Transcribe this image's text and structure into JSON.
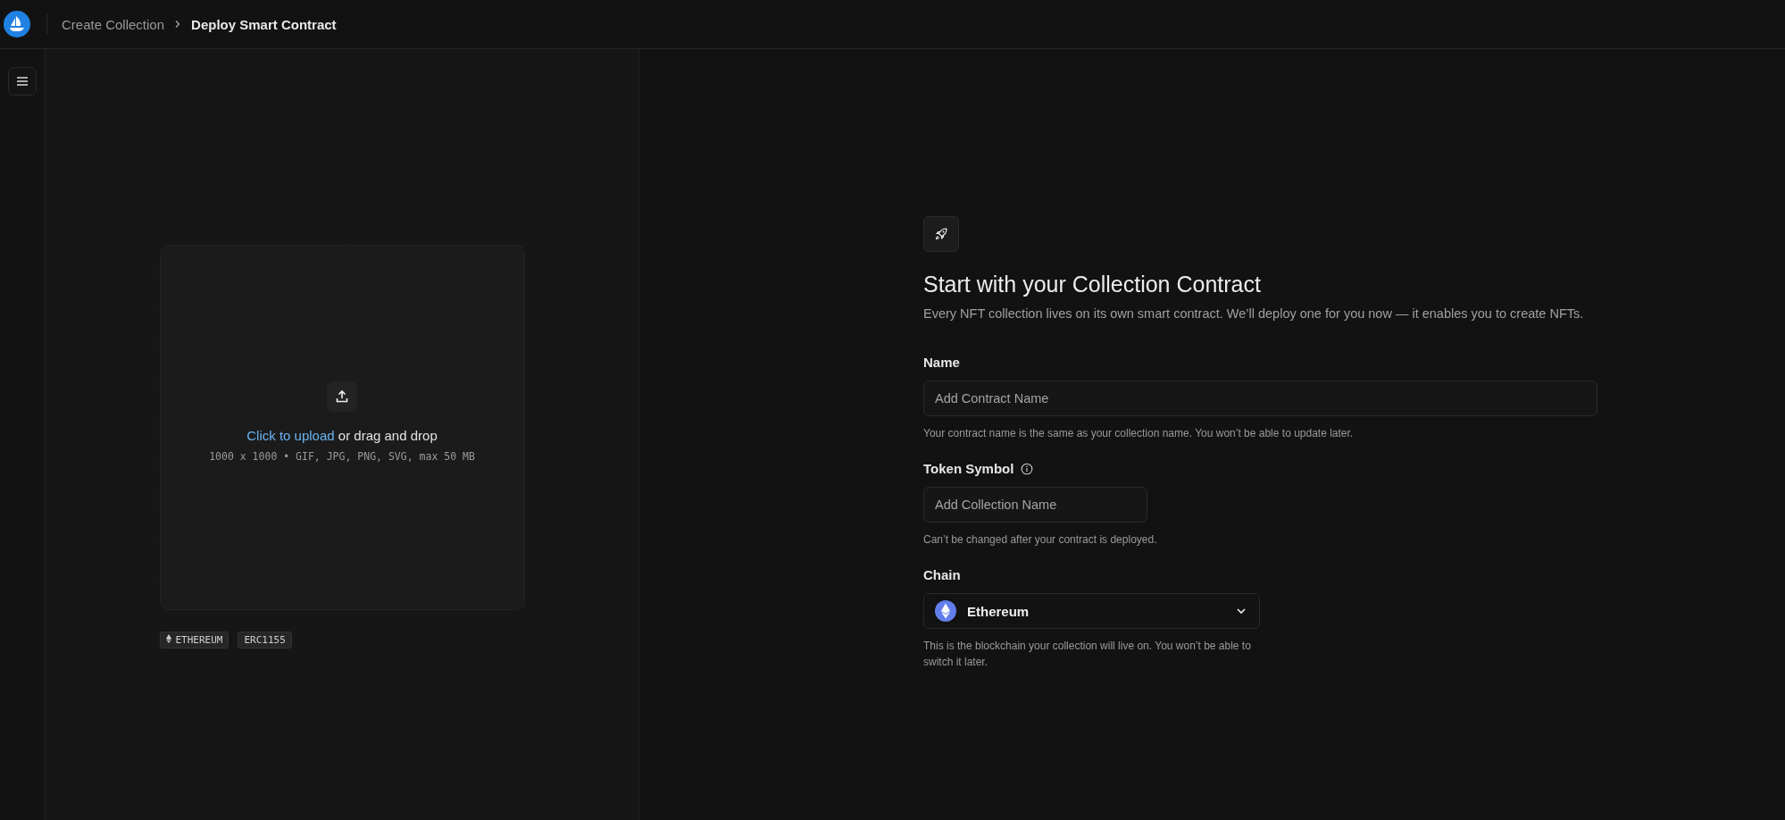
{
  "breadcrumbs": [
    {
      "label": "Create Collection",
      "selected": false
    },
    {
      "label": "Deploy Smart Contract",
      "selected": true
    }
  ],
  "upload": {
    "link": "Click to upload",
    "rest": "or drag and drop",
    "hint": "1000 x 1000 • GIF, JPG, PNG, SVG, max 50 MB"
  },
  "tags": [
    {
      "label": "ETHEREUM",
      "kind": "chain"
    },
    {
      "label": "ERC1155",
      "kind": "plain"
    }
  ],
  "form": {
    "title": "Start with your Collection Contract",
    "subtitle": "Every NFT collection lives on its own smart contract. We’ll deploy one for you now — it enables you to create NFTs.",
    "fields": [
      {
        "kind": "input",
        "label": "Name",
        "placeholder": "Add Contract Name",
        "help": "Your contract name is the same as your collection name. You won’t be able to update later.",
        "info": false
      },
      {
        "kind": "input",
        "label": "Token Symbol",
        "placeholder": "Add Collection Name",
        "help": "Can’t be changed after your contract is deployed.",
        "info": true
      },
      {
        "kind": "select",
        "label": "Chain",
        "value": "Ethereum",
        "help": "This is the blockchain your collection will live on. You won’t be able to switch it later.",
        "info": false
      }
    ]
  }
}
